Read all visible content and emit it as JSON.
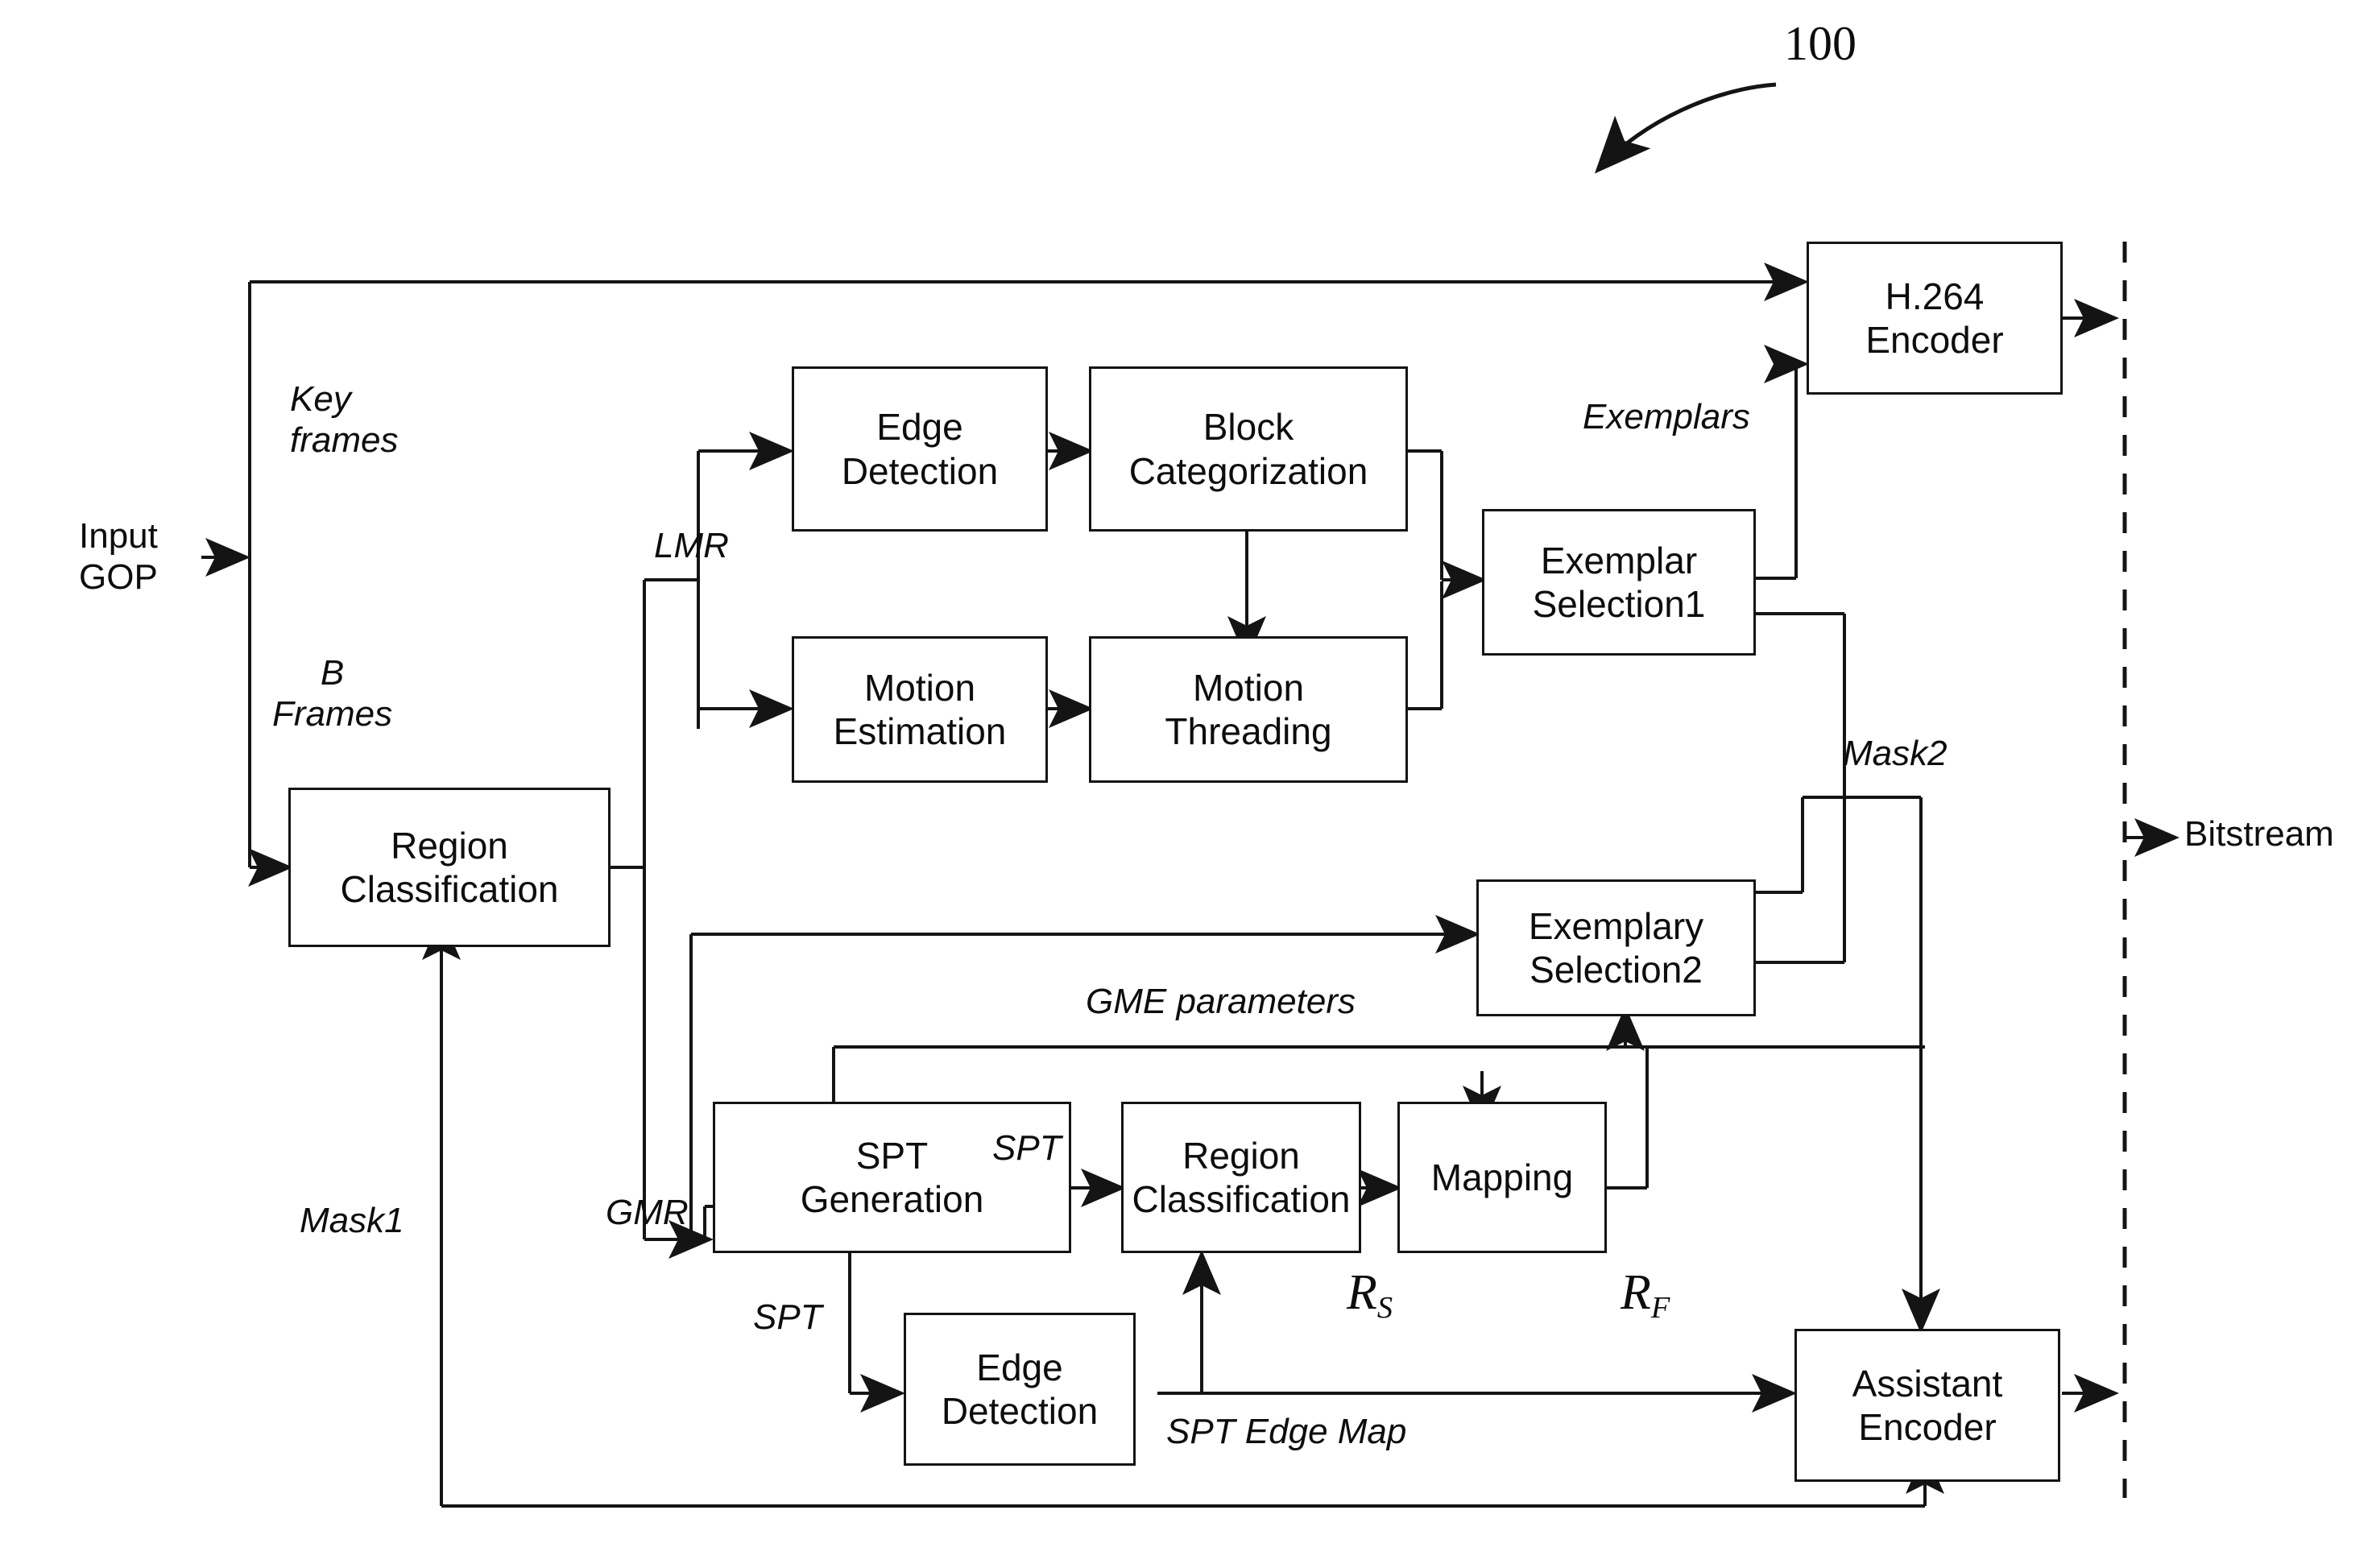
{
  "figure": {
    "reference_numeral": "100",
    "kind": "patent-block-diagram",
    "ink_color": "#141414",
    "background": "#ffffff"
  },
  "nodes": {
    "h264_encoder": {
      "label": "H.264\nEncoder"
    },
    "edge_detection_top": {
      "label": "Edge\nDetection"
    },
    "block_categorization": {
      "label": "Block\nCategorization"
    },
    "motion_estimation": {
      "label": "Motion\nEstimation"
    },
    "motion_threading": {
      "label": "Motion\nThreading"
    },
    "exemplar_selection1": {
      "label": "Exemplar\nSelection1"
    },
    "exemplary_selection2": {
      "label": "Exemplary\nSelection2"
    },
    "region_classification_left": {
      "label": "Region\nClassification"
    },
    "spt_generation": {
      "label": "SPT\nGeneration"
    },
    "region_classification_bottom": {
      "label": "Region\nClassification"
    },
    "mapping": {
      "label": "Mapping"
    },
    "edge_detection_bottom": {
      "label": "Edge\nDetection"
    },
    "assistant_encoder": {
      "label": "Assistant\nEncoder"
    }
  },
  "signals": {
    "input_gop": "Input\nGOP",
    "key_frames": "Key\nframes",
    "b_frames": "B\nFrames",
    "lmr": "LMR",
    "gmr": "GMR",
    "exemplars": "Exemplars",
    "mask1": "Mask1",
    "mask2": "Mask2",
    "gme_parameters": "GME parameters",
    "spt_to_region": "SPT",
    "spt_to_edge": "SPT",
    "spt_edge_map": "SPT Edge Map",
    "bitstream": "Bitstream",
    "r_s_base": "R",
    "r_s_sub": "S",
    "r_f_base": "R",
    "r_f_sub": "F"
  }
}
